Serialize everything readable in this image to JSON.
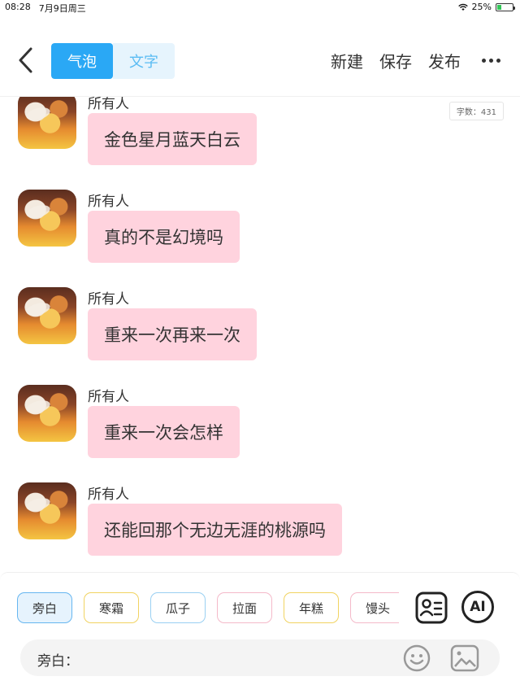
{
  "status_bar": {
    "time": "08:28",
    "date": "7月9日周三",
    "battery": "25%",
    "battery_level": 0.25
  },
  "header": {
    "tabs": [
      {
        "label": "气泡",
        "active": true
      },
      {
        "label": "文字",
        "active": false
      }
    ],
    "actions": {
      "new": "新建",
      "save": "保存",
      "publish": "发布"
    }
  },
  "chat": {
    "word_count": "字数：431",
    "messages": [
      {
        "sender": "所有人",
        "text": "金色星月蓝天白云"
      },
      {
        "sender": "所有人",
        "text": "真的不是幻境吗"
      },
      {
        "sender": "所有人",
        "text": "重来一次再来一次"
      },
      {
        "sender": "所有人",
        "text": "重来一次会怎样"
      },
      {
        "sender": "所有人",
        "text": "还能回那个无边无涯的桃源吗"
      }
    ]
  },
  "characters": [
    "旁白",
    "寒霜",
    "瓜子",
    "拉面",
    "年糕",
    "馒头"
  ],
  "buttons": {
    "ai": "AI"
  },
  "input": {
    "prefix": "旁白：",
    "value": "",
    "placeholder": ""
  },
  "colors": {
    "accent": "#2aa8f5",
    "bubble": "#ffd3de",
    "tab_inactive_bg": "#e6f4fd"
  }
}
